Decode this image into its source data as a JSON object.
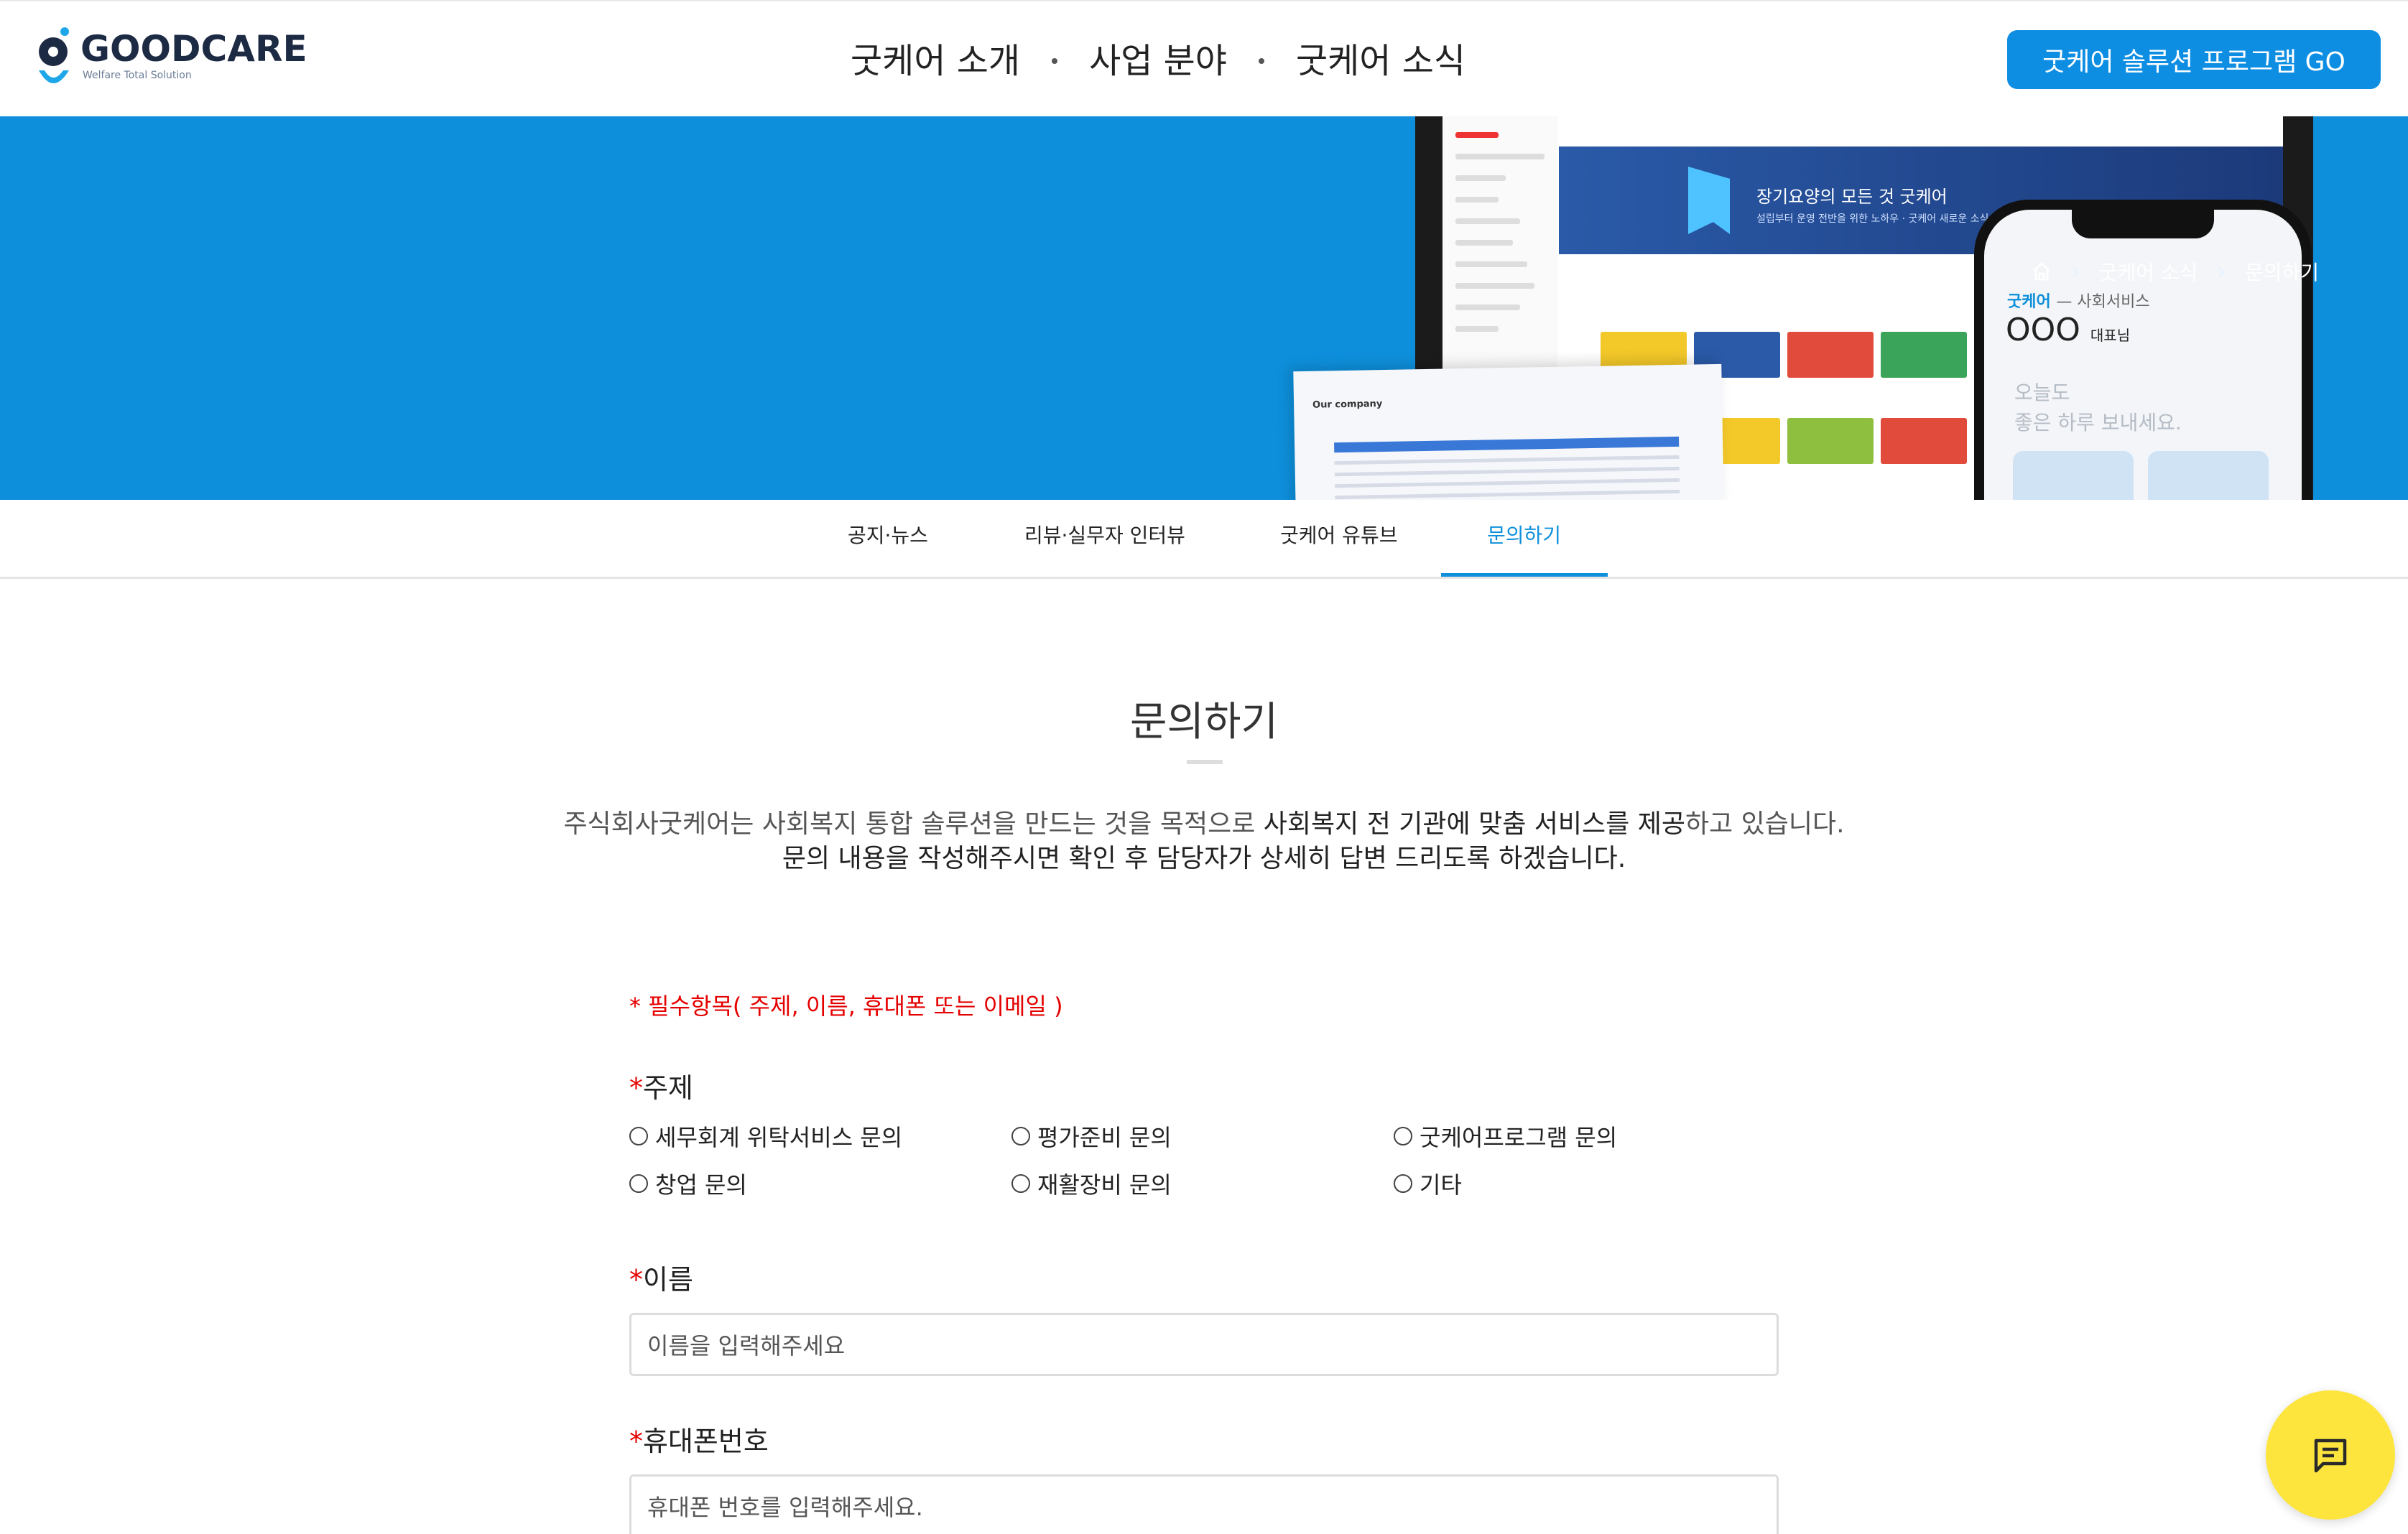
{
  "header": {
    "logo_text": "GOODCARE",
    "logo_sub": "Welfare Total Solution",
    "nav": [
      "굿케어 소개",
      "사업 분야",
      "굿케어 소식"
    ],
    "cta_label": "굿케어 솔루션 프로그램 GO"
  },
  "hero": {
    "breadcrumb": [
      "굿케어 소식",
      "문의하기"
    ],
    "youtube_title": "장기요양의 모든 것 굿케어",
    "youtube_sub": "설립부터 운영 전반을 위한 노하우 · 굿케어 새로운 소식",
    "paper_title": "Our company",
    "phone_brand": "굿케어",
    "phone_brand_sub": "— 사회서비스",
    "phone_name": "OOO",
    "phone_name_suffix": "대표님",
    "phone_greeting_1": "오늘도",
    "phone_greeting_2": "좋은 하루 보내세요."
  },
  "tabs": [
    {
      "label": "공지·뉴스",
      "active": false
    },
    {
      "label": "리뷰·실무자 인터뷰",
      "active": false
    },
    {
      "label": "굿케어 유튜브",
      "active": false
    },
    {
      "label": "문의하기",
      "active": true
    }
  ],
  "content": {
    "title": "문의하기",
    "intro_line1_a": "주식회사굿케어는 사회복지 통합 솔루션을 만드는 것을 목적으로 ",
    "intro_line1_b": "사회복지 전 기관에 맞춤 서비스를 제공",
    "intro_line1_c": "하고 있습니다.",
    "intro_line2": "문의 내용을 작성해주시면 확인 후 담당자가 상세히 답변 드리도록 하겠습니다."
  },
  "form": {
    "required_note": "* 필수항목( 주제, 이름, 휴대폰 또는 이메일 )",
    "subject_label": "주제",
    "subject_options": [
      "세무회계 위탁서비스 문의",
      "평가준비 문의",
      "굿케어프로그램 문의",
      "창업 문의",
      "재활장비 문의",
      "기타"
    ],
    "name_label": "이름",
    "name_placeholder": "이름을 입력해주세요",
    "phone_label": "휴대폰번호",
    "phone_placeholder": "휴대폰 번호를 입력해주세요."
  },
  "colors": {
    "brand_blue": "#0e8fdb",
    "cta_blue": "#0e8ee3",
    "required_red": "#e50000",
    "chat_yellow": "#fde53d"
  }
}
